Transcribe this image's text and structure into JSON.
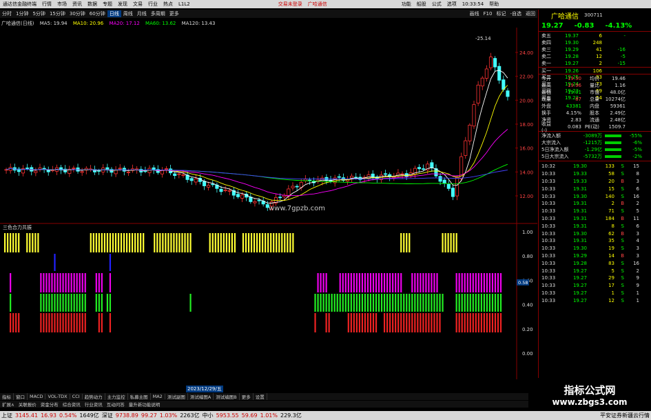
{
  "topbar": {
    "app_title": "通达信金融终端",
    "menu": [
      "行情",
      "市场",
      "资讯",
      "数据",
      "专题",
      "发现",
      "文易",
      "行业",
      "热点",
      "L1L2"
    ],
    "login": "交易未登录",
    "broker": "广哈通信",
    "right_menu": [
      "功能",
      "船股",
      "公式",
      "选项",
      "10:33:54",
      "帮助"
    ]
  },
  "timeframes": [
    "分时",
    "1分钟",
    "5分钟",
    "15分钟",
    "30分钟",
    "60分钟",
    "日线",
    "周线",
    "月线",
    "多周期",
    "更多"
  ],
  "active_timeframe": "日线",
  "toolbar_right": [
    "画线",
    "F10",
    "标记",
    "-自选",
    "返回"
  ],
  "ma_bar": {
    "stock": "广哈通信(日线)",
    "ma5": "MA5: 19.94",
    "ma10": "MA10: 20.96",
    "ma20": "MA20: 17.12",
    "ma60": "MA60: 13.62",
    "ma120": "MA120: 13.43"
  },
  "stock": {
    "name": "广哈通信",
    "code": "300711",
    "price": "19.27",
    "change": "-0.83",
    "pct": "-4.13%"
  },
  "orderbook": [
    {
      "label": "卖五",
      "price": "19.37",
      "vol": "6",
      "chg": "-"
    },
    {
      "label": "卖四",
      "price": "19.30",
      "vol": "248",
      "chg": ""
    },
    {
      "label": "卖三",
      "price": "19.29",
      "vol": "41",
      "chg": "-16"
    },
    {
      "label": "卖二",
      "price": "19.28",
      "vol": "12",
      "chg": "-5"
    },
    {
      "label": "卖一",
      "price": "19.27",
      "vol": "2",
      "chg": "-15"
    },
    {
      "label": "买一",
      "price": "19.26",
      "vol": "106",
      "chg": ""
    },
    {
      "label": "买二",
      "price": "19.25",
      "vol": "93",
      "chg": ""
    },
    {
      "label": "买三",
      "price": "19.24",
      "vol": "73",
      "chg": ""
    },
    {
      "label": "买四",
      "price": "19.23",
      "vol": "69",
      "chg": ""
    },
    {
      "label": "买五",
      "price": "19.22",
      "vol": "54",
      "chg": ""
    }
  ],
  "stats": [
    {
      "k": "今开",
      "v1": "19.50",
      "k2": "均价",
      "v2": "19.46"
    },
    {
      "k": "最高",
      "v1": "19.96",
      "k2": "量比",
      "v2": "1.16"
    },
    {
      "k": "最低",
      "v1": "19.01",
      "k2": "市值",
      "v2": "48.0亿"
    },
    {
      "k": "现量",
      "v1": "87",
      "k2": "总量",
      "v2": "10274亿"
    },
    {
      "k": "外盘",
      "v1": "43381",
      "k2": "内盘",
      "v2": "59361"
    },
    {
      "k": "换手",
      "v1": "4.15%",
      "k2": "股本",
      "v2": "2.49亿"
    },
    {
      "k": "净资",
      "v1": "2.83",
      "k2": "流通",
      "v2": "2.48亿"
    },
    {
      "k": "收益(-)",
      "v1": "0.083",
      "k2": "PE(动)",
      "v2": "1509.7"
    }
  ],
  "flow": [
    {
      "k": "净流入额",
      "v": "-3089万",
      "pct": "-55%"
    },
    {
      "k": "大宗流入",
      "v": "-1215万",
      "pct": "-6%"
    },
    {
      "k": "5日净流入额",
      "v": "-1.29亿",
      "pct": "-5%"
    },
    {
      "k": "5日大宗流入",
      "v": "-5732万",
      "pct": "-2%"
    }
  ],
  "ticks": [
    {
      "t": "10:32",
      "p": "19.30",
      "v": "133",
      "s": "S",
      "n": "15"
    },
    {
      "t": "10:33",
      "p": "19.33",
      "v": "58",
      "s": "S",
      "n": "8"
    },
    {
      "t": "10:33",
      "p": "19.33",
      "v": "20",
      "s": "B",
      "n": "3"
    },
    {
      "t": "10:33",
      "p": "19.31",
      "v": "15",
      "s": "S",
      "n": "6"
    },
    {
      "t": "10:33",
      "p": "19.30",
      "v": "140",
      "s": "S",
      "n": "16"
    },
    {
      "t": "10:33",
      "p": "19.31",
      "v": "2",
      "s": "B",
      "n": "2"
    },
    {
      "t": "10:33",
      "p": "19.31",
      "v": "71",
      "s": "S",
      "n": "5"
    },
    {
      "t": "10:33",
      "p": "19.31",
      "v": "184",
      "s": "B",
      "n": "11"
    },
    {
      "t": "10:33",
      "p": "19.31",
      "v": "8",
      "s": "S",
      "n": "6"
    },
    {
      "t": "10:33",
      "p": "19.30",
      "v": "62",
      "s": "B",
      "n": "3"
    },
    {
      "t": "10:33",
      "p": "19.31",
      "v": "35",
      "s": "S",
      "n": "4"
    },
    {
      "t": "10:33",
      "p": "19.30",
      "v": "19",
      "s": "S",
      "n": "3"
    },
    {
      "t": "10:33",
      "p": "19.29",
      "v": "14",
      "s": "B",
      "n": "3"
    },
    {
      "t": "10:33",
      "p": "19.28",
      "v": "83",
      "s": "S",
      "n": "16"
    },
    {
      "t": "10:33",
      "p": "19.27",
      "v": "5",
      "s": "S",
      "n": "2"
    },
    {
      "t": "10:33",
      "p": "19.27",
      "v": "29",
      "s": "S",
      "n": "9"
    },
    {
      "t": "10:33",
      "p": "19.27",
      "v": "17",
      "s": "S",
      "n": "9"
    },
    {
      "t": "10:33",
      "p": "19.27",
      "v": "1",
      "s": "S",
      "n": "1"
    },
    {
      "t": "10:33",
      "p": "19.27",
      "v": "12",
      "s": "S",
      "n": "1"
    }
  ],
  "chart": {
    "price_ticks": [
      "24.00",
      "22.00",
      "20.00",
      "18.00",
      "16.00",
      "14.00",
      "12.00"
    ],
    "high_label": "25.14",
    "ind_ticks": [
      "1.00",
      "0.80",
      "0.60",
      "0.40",
      "0.20",
      "0.00"
    ],
    "ind_marker": "0.58",
    "date_marks": [
      "2023年11",
      "12",
      "2023/12/29/五"
    ],
    "site": "www.7gpzb.com",
    "indicator_title": "三色合力共振",
    "tags": [
      "分析",
      "复权"
    ]
  },
  "bottom_tabs": [
    "指标",
    "窗口",
    "MACD",
    "VOL-TDX",
    "CCI",
    "趋势动力",
    "主力监控",
    "私募主图",
    "MA2",
    "测试副图",
    "测试编图A",
    "测试编图B",
    "更多",
    "设置"
  ],
  "bottom_tabs2": [
    "扩展∧",
    "关联报价",
    "资金分布",
    "综合资讯",
    "行业资讯",
    "互动问答",
    "量升新功能说明"
  ],
  "statusbar": {
    "sh": "上证",
    "sh_v": "3145.41",
    "sh_c": "16.93",
    "sh_p": "0.54%",
    "sh_a": "1649亿",
    "sz": "深证",
    "sz_v": "9738.89",
    "sz_c": "99.27",
    "sz_p": "1.03%",
    "sz_a": "2263亿",
    "cy": "中小",
    "cy_v": "5953.55",
    "cy_c": "59.69",
    "cy_p": "1.01%",
    "cy_a": "229.3亿",
    "right": "平安证券新疆云行情"
  },
  "watermark": {
    "a": "指标公式网",
    "b": "www.zbgs3.com"
  }
}
